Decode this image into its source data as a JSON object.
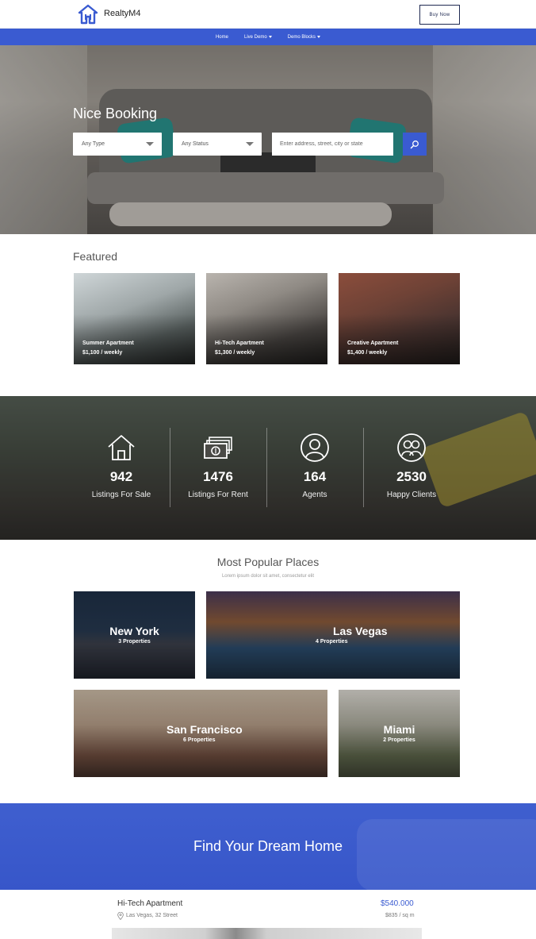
{
  "header": {
    "brand": "RealtyM4",
    "buy_label": "Buy Now"
  },
  "nav": {
    "items": [
      {
        "label": "Home",
        "dropdown": false
      },
      {
        "label": "Live Demo",
        "dropdown": true
      },
      {
        "label": "Demo Blocks",
        "dropdown": true
      }
    ]
  },
  "hero": {
    "title": "Nice Booking",
    "type_select": "Any Type",
    "status_select": "Any Status",
    "search_placeholder": "Enter address, street, city or state"
  },
  "featured": {
    "title": "Featured",
    "cards": [
      {
        "title": "Summer Apartment",
        "price": "$1,100 / weekly"
      },
      {
        "title": "Hi-Tech Apartment",
        "price": "$1,300 / weekly"
      },
      {
        "title": "Creative Apartment",
        "price": "$1,400 / weekly"
      }
    ]
  },
  "stats": [
    {
      "value": "942",
      "label": "Listings For Sale",
      "icon": "house-icon"
    },
    {
      "value": "1476",
      "label": "Listings For Rent",
      "icon": "money-icon"
    },
    {
      "value": "164",
      "label": "Agents",
      "icon": "agent-icon"
    },
    {
      "value": "2530",
      "label": "Happy Clients",
      "icon": "clients-icon"
    }
  ],
  "popular": {
    "title": "Most Popular Places",
    "subtitle": "Lorem ipsum dolor sit amet, consectetur elit",
    "places": [
      {
        "name": "New York",
        "count": "3 Properties"
      },
      {
        "name": "Las Vegas",
        "count": "4 Properties"
      },
      {
        "name": "San Francisco",
        "count": "6 Properties"
      },
      {
        "name": "Miami",
        "count": "2 Properties"
      }
    ]
  },
  "dream": {
    "title": "Find Your Dream Home"
  },
  "listing": {
    "name": "Hi-Tech Apartment",
    "address": "Las Vegas, 32 Street",
    "price": "$540.000",
    "unit_price": "$835 / sq m"
  },
  "colors": {
    "accent": "#3a5bd1",
    "dark": "#1f2a52"
  }
}
